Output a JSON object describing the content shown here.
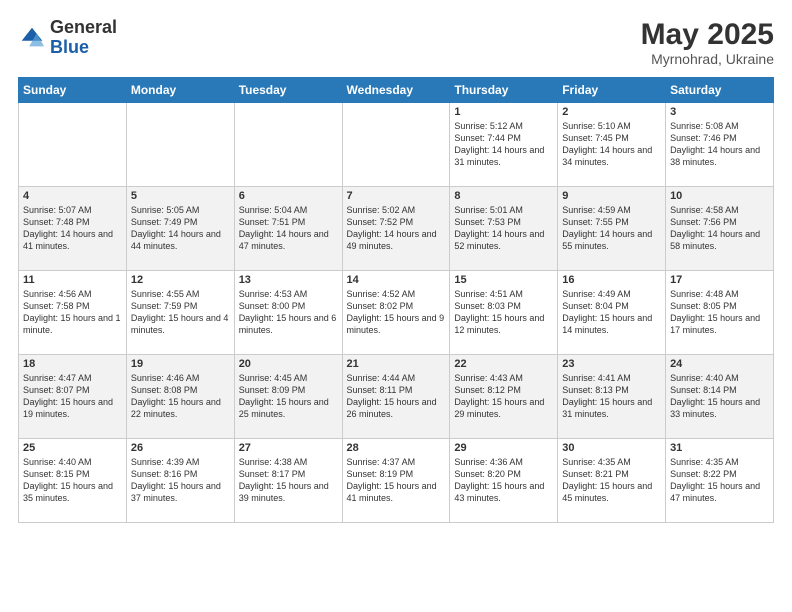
{
  "header": {
    "logo_general": "General",
    "logo_blue": "Blue",
    "title": "May 2025",
    "location": "Myrnohrad, Ukraine"
  },
  "days_of_week": [
    "Sunday",
    "Monday",
    "Tuesday",
    "Wednesday",
    "Thursday",
    "Friday",
    "Saturday"
  ],
  "weeks": [
    [
      {
        "day": "",
        "info": ""
      },
      {
        "day": "",
        "info": ""
      },
      {
        "day": "",
        "info": ""
      },
      {
        "day": "",
        "info": ""
      },
      {
        "day": "1",
        "info": "Sunrise: 5:12 AM\nSunset: 7:44 PM\nDaylight: 14 hours\nand 31 minutes."
      },
      {
        "day": "2",
        "info": "Sunrise: 5:10 AM\nSunset: 7:45 PM\nDaylight: 14 hours\nand 34 minutes."
      },
      {
        "day": "3",
        "info": "Sunrise: 5:08 AM\nSunset: 7:46 PM\nDaylight: 14 hours\nand 38 minutes."
      }
    ],
    [
      {
        "day": "4",
        "info": "Sunrise: 5:07 AM\nSunset: 7:48 PM\nDaylight: 14 hours\nand 41 minutes."
      },
      {
        "day": "5",
        "info": "Sunrise: 5:05 AM\nSunset: 7:49 PM\nDaylight: 14 hours\nand 44 minutes."
      },
      {
        "day": "6",
        "info": "Sunrise: 5:04 AM\nSunset: 7:51 PM\nDaylight: 14 hours\nand 47 minutes."
      },
      {
        "day": "7",
        "info": "Sunrise: 5:02 AM\nSunset: 7:52 PM\nDaylight: 14 hours\nand 49 minutes."
      },
      {
        "day": "8",
        "info": "Sunrise: 5:01 AM\nSunset: 7:53 PM\nDaylight: 14 hours\nand 52 minutes."
      },
      {
        "day": "9",
        "info": "Sunrise: 4:59 AM\nSunset: 7:55 PM\nDaylight: 14 hours\nand 55 minutes."
      },
      {
        "day": "10",
        "info": "Sunrise: 4:58 AM\nSunset: 7:56 PM\nDaylight: 14 hours\nand 58 minutes."
      }
    ],
    [
      {
        "day": "11",
        "info": "Sunrise: 4:56 AM\nSunset: 7:58 PM\nDaylight: 15 hours\nand 1 minute."
      },
      {
        "day": "12",
        "info": "Sunrise: 4:55 AM\nSunset: 7:59 PM\nDaylight: 15 hours\nand 4 minutes."
      },
      {
        "day": "13",
        "info": "Sunrise: 4:53 AM\nSunset: 8:00 PM\nDaylight: 15 hours\nand 6 minutes."
      },
      {
        "day": "14",
        "info": "Sunrise: 4:52 AM\nSunset: 8:02 PM\nDaylight: 15 hours\nand 9 minutes."
      },
      {
        "day": "15",
        "info": "Sunrise: 4:51 AM\nSunset: 8:03 PM\nDaylight: 15 hours\nand 12 minutes."
      },
      {
        "day": "16",
        "info": "Sunrise: 4:49 AM\nSunset: 8:04 PM\nDaylight: 15 hours\nand 14 minutes."
      },
      {
        "day": "17",
        "info": "Sunrise: 4:48 AM\nSunset: 8:05 PM\nDaylight: 15 hours\nand 17 minutes."
      }
    ],
    [
      {
        "day": "18",
        "info": "Sunrise: 4:47 AM\nSunset: 8:07 PM\nDaylight: 15 hours\nand 19 minutes."
      },
      {
        "day": "19",
        "info": "Sunrise: 4:46 AM\nSunset: 8:08 PM\nDaylight: 15 hours\nand 22 minutes."
      },
      {
        "day": "20",
        "info": "Sunrise: 4:45 AM\nSunset: 8:09 PM\nDaylight: 15 hours\nand 25 minutes."
      },
      {
        "day": "21",
        "info": "Sunrise: 4:44 AM\nSunset: 8:11 PM\nDaylight: 15 hours\nand 26 minutes."
      },
      {
        "day": "22",
        "info": "Sunrise: 4:43 AM\nSunset: 8:12 PM\nDaylight: 15 hours\nand 29 minutes."
      },
      {
        "day": "23",
        "info": "Sunrise: 4:41 AM\nSunset: 8:13 PM\nDaylight: 15 hours\nand 31 minutes."
      },
      {
        "day": "24",
        "info": "Sunrise: 4:40 AM\nSunset: 8:14 PM\nDaylight: 15 hours\nand 33 minutes."
      }
    ],
    [
      {
        "day": "25",
        "info": "Sunrise: 4:40 AM\nSunset: 8:15 PM\nDaylight: 15 hours\nand 35 minutes."
      },
      {
        "day": "26",
        "info": "Sunrise: 4:39 AM\nSunset: 8:16 PM\nDaylight: 15 hours\nand 37 minutes."
      },
      {
        "day": "27",
        "info": "Sunrise: 4:38 AM\nSunset: 8:17 PM\nDaylight: 15 hours\nand 39 minutes."
      },
      {
        "day": "28",
        "info": "Sunrise: 4:37 AM\nSunset: 8:19 PM\nDaylight: 15 hours\nand 41 minutes."
      },
      {
        "day": "29",
        "info": "Sunrise: 4:36 AM\nSunset: 8:20 PM\nDaylight: 15 hours\nand 43 minutes."
      },
      {
        "day": "30",
        "info": "Sunrise: 4:35 AM\nSunset: 8:21 PM\nDaylight: 15 hours\nand 45 minutes."
      },
      {
        "day": "31",
        "info": "Sunrise: 4:35 AM\nSunset: 8:22 PM\nDaylight: 15 hours\nand 47 minutes."
      }
    ]
  ]
}
